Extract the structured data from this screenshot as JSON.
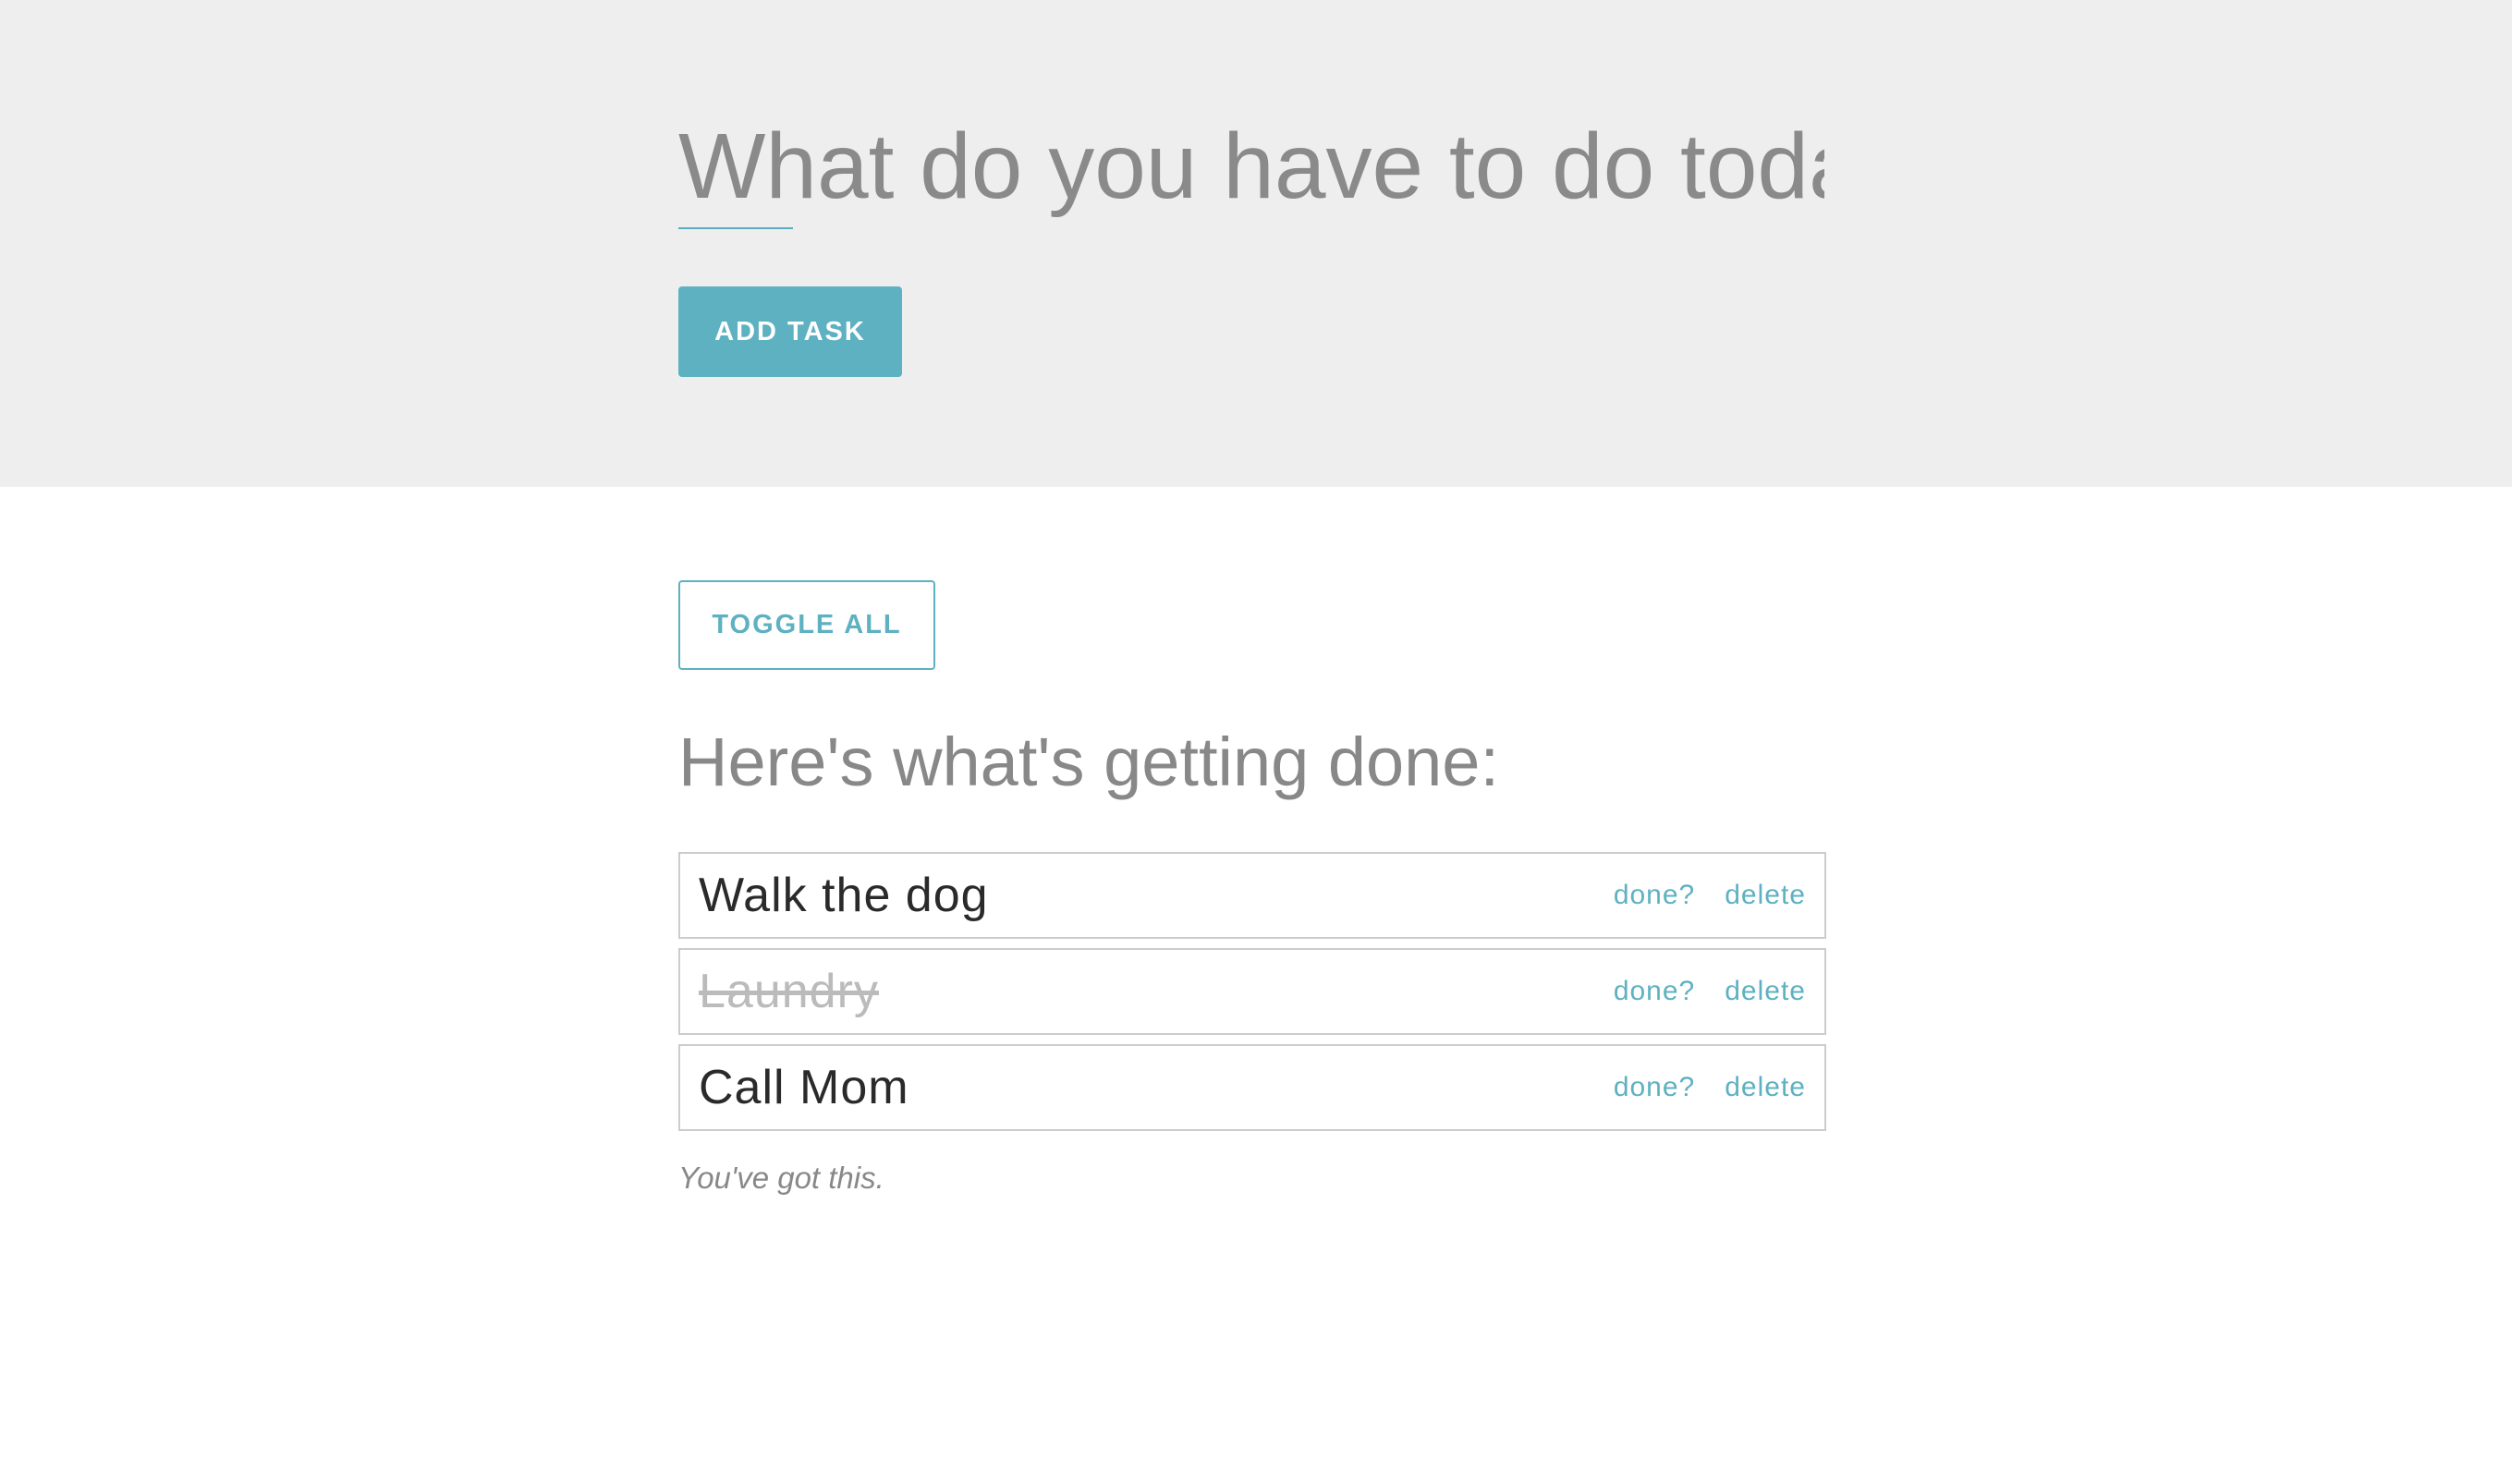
{
  "header": {
    "input_placeholder": "What do you have to do today?",
    "input_value": "",
    "add_button_label": "ADD TASK"
  },
  "main": {
    "toggle_all_label": "TOGGLE ALL",
    "list_heading": "Here's what's getting done:",
    "tasks": [
      {
        "text": "Walk the dog",
        "completed": false,
        "done_label": "done?",
        "delete_label": "delete"
      },
      {
        "text": "Laundry",
        "completed": true,
        "done_label": "done?",
        "delete_label": "delete"
      },
      {
        "text": "Call Mom",
        "completed": false,
        "done_label": "done?",
        "delete_label": "delete"
      }
    ],
    "footer_note": "You've got this."
  },
  "colors": {
    "accent": "#5eb1c1",
    "header_background": "#eeeeee",
    "completed_text": "#bbbbbb",
    "muted_text": "#888888"
  }
}
